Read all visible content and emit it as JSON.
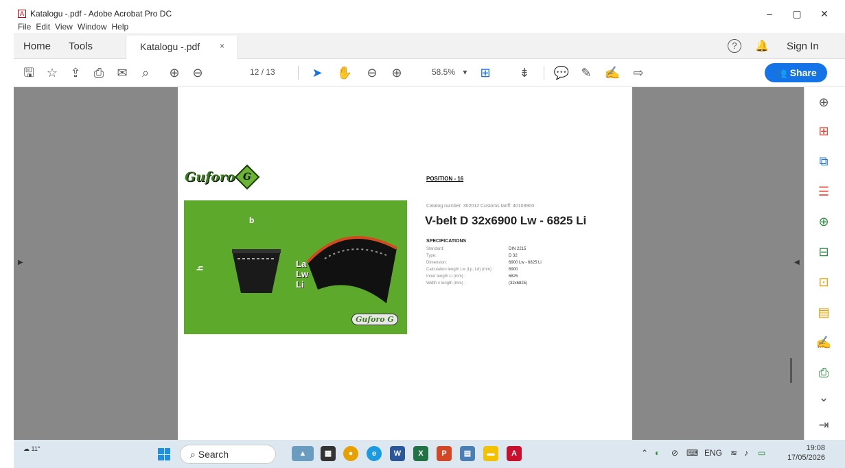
{
  "window": {
    "title": "Katalogu -.pdf - Adobe Acrobat Pro DC",
    "controls": [
      "–",
      "▢",
      "✕"
    ]
  },
  "menu": [
    "File",
    "Edit",
    "View",
    "Window",
    "Help"
  ],
  "tabs": {
    "home": "Home",
    "tools": "Tools",
    "document": "Katalogu -.pdf",
    "close": "×",
    "help": "?",
    "sign_in": "Sign In"
  },
  "toolbar": {
    "page_current": "12",
    "page_total": "/ 13",
    "zoom": "58.5%",
    "zoom_caret": "▾",
    "share_label": "Share"
  },
  "document": {
    "logo_text": "Guforo",
    "logo_letter": "G",
    "position": "POSITION - 16",
    "catalog_line": "Catalog number: 302012     Customs tariff: 40103900",
    "product_title": "V-belt D 32x6900 Lw - 6825 Li",
    "figure_labels": {
      "b": "b",
      "h": "h",
      "la": "La",
      "lw": "Lw",
      "li": "Li"
    },
    "figure_stamp": "Guforo G",
    "spec_heading": "SPECIFICATIONS",
    "specs": [
      {
        "key": "Standard:",
        "value": "DIN 2215"
      },
      {
        "key": "Type:",
        "value": "D 32"
      },
      {
        "key": "Dimension:",
        "value": "6900 Lw - 6825 Li"
      },
      {
        "key": "Calculation length Lw (Lp, Ld) (mm) :",
        "value": "6900"
      },
      {
        "key": "Inner length Li (mm) :",
        "value": "6825"
      },
      {
        "key": "Width x length (mm) :",
        "value": "(32x6825)"
      }
    ]
  },
  "taskbar": {
    "weather": "11°",
    "search_placeholder": "Search",
    "language": "ENG",
    "time": "19:08",
    "date": "17/05/2026"
  },
  "colors": {
    "accent": "#1473e6",
    "doc_background": "#888888",
    "figure_green": "#5ca92c"
  }
}
